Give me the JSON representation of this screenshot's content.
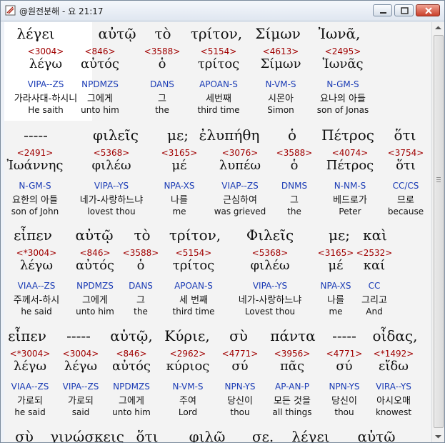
{
  "window": {
    "title": "@원전분해 - 요 21:17"
  },
  "blocks": [
    {
      "top_words": [
        "λέγει",
        "αὐτῷ",
        "τὸ",
        "τρίτον,",
        "Σίμων",
        "Ἰωνᾶ,"
      ],
      "entries": [
        {
          "num": "<3004>",
          "lemma": "λέγω",
          "parse": "VIPA--ZS",
          "kor": "가라사대-하시니",
          "eng": "He saith"
        },
        {
          "num": "<846>",
          "lemma": "αὐτός",
          "parse": "NPDMZS",
          "kor": "그에게",
          "eng": "unto him"
        },
        {
          "num": "<3588>",
          "lemma": "ὁ",
          "parse": "DANS",
          "kor": "그",
          "eng": "the"
        },
        {
          "num": "<5154>",
          "lemma": "τρίτος",
          "parse": "APOAN-S",
          "kor": "세번째",
          "eng": "third time"
        },
        {
          "num": "<4613>",
          "lemma": "Σίμων",
          "parse": "N-VM-S",
          "kor": "시몬아",
          "eng": "Simon"
        },
        {
          "num": "<2495>",
          "lemma": "Ἰωνᾶς",
          "parse": "N-GM-S",
          "kor": "요나의 아들",
          "eng": "son of Jonas"
        }
      ]
    },
    {
      "top_words": [
        "-----",
        "φιλεῖς",
        "με;",
        "ἐλυπήθη",
        "ὁ",
        "Πέτρος",
        "ὅτι"
      ],
      "entries": [
        {
          "num": "<2491>",
          "lemma": "Ἰωάννης",
          "parse": "N-GM-S",
          "kor": "요한의 아들",
          "eng": "son of John"
        },
        {
          "num": "<5368>",
          "lemma": "φιλέω",
          "parse": "VIPA--YS",
          "kor": "네가-사랑하느냐",
          "eng": "lovest thou"
        },
        {
          "num": "<3165>",
          "lemma": "μέ",
          "parse": "NPA-XS",
          "kor": "나를",
          "eng": "me"
        },
        {
          "num": "<3076>",
          "lemma": "λυπέω",
          "parse": "VIAP--ZS",
          "kor": "근심하여",
          "eng": "was grieved"
        },
        {
          "num": "<3588>",
          "lemma": "ὁ",
          "parse": "DNMS",
          "kor": "그",
          "eng": "the"
        },
        {
          "num": "<4074>",
          "lemma": "Πέτρος",
          "parse": "N-NM-S",
          "kor": "베드로가",
          "eng": "Peter"
        },
        {
          "num": "<3754>",
          "lemma": "ὅτι",
          "parse": "CC/CS",
          "kor": "므로",
          "eng": "because"
        }
      ]
    },
    {
      "top_words": [
        "εἶπεν",
        "αὐτῷ",
        "τὸ",
        "τρίτον,",
        "Φιλεῖς",
        "με;",
        "καὶ"
      ],
      "entries": [
        {
          "num": "<*3004>",
          "lemma": "λέγω",
          "parse": "VIAA--ZS",
          "kor": "주께서-하시",
          "eng": "he said"
        },
        {
          "num": "<846>",
          "lemma": "αὐτός",
          "parse": "NPDMZS",
          "kor": "그에게",
          "eng": "unto him"
        },
        {
          "num": "<3588>",
          "lemma": "ὁ",
          "parse": "DANS",
          "kor": "그",
          "eng": "the"
        },
        {
          "num": "<5154>",
          "lemma": "τρίτος",
          "parse": "APOAN-S",
          "kor": "세 번째",
          "eng": "third time"
        },
        {
          "num": "<5368>",
          "lemma": "φιλέω",
          "parse": "VIPA--YS",
          "kor": "네가-사랑하느냐",
          "eng": "Lovest thou"
        },
        {
          "num": "<3165>",
          "lemma": "μέ",
          "parse": "NPA-XS",
          "kor": "나를",
          "eng": "me"
        },
        {
          "num": "<2532>",
          "lemma": "καί",
          "parse": "CC",
          "kor": "그리고",
          "eng": "And"
        }
      ]
    },
    {
      "top_words": [
        "εἶπεν",
        "-----",
        "αὐτῷ,",
        "Κύριε,",
        "σὺ",
        "πάντα",
        "-----",
        "οἶδας,"
      ],
      "entries": [
        {
          "num": "<*3004>",
          "lemma": "λέγω",
          "parse": "VIAA--ZS",
          "kor": "가로되",
          "eng": "he said"
        },
        {
          "num": "<3004>",
          "lemma": "λέγω",
          "parse": "VIPA--ZS",
          "kor": "가로되",
          "eng": "said"
        },
        {
          "num": "<846>",
          "lemma": "αὐτός",
          "parse": "NPDMZS",
          "kor": "그에게",
          "eng": "unto him"
        },
        {
          "num": "<2962>",
          "lemma": "κύριος",
          "parse": "N-VM-S",
          "kor": "주여",
          "eng": "Lord"
        },
        {
          "num": "<4771>",
          "lemma": "σύ",
          "parse": "NPN-YS",
          "kor": "당신이",
          "eng": "thou"
        },
        {
          "num": "<3956>",
          "lemma": "πᾶς",
          "parse": "AP-AN-P",
          "kor": "모든 것을",
          "eng": "all things"
        },
        {
          "num": "<4771>",
          "lemma": "σύ",
          "parse": "NPN-YS",
          "kor": "당신이",
          "eng": "thou"
        },
        {
          "num": "<*1492>",
          "lemma": "εἴδω",
          "parse": "VIRA--YS",
          "kor": "아시오매",
          "eng": "knowest"
        }
      ]
    },
    {
      "top_words": [
        "σὺ",
        "γινώσκεις",
        "ὅτι",
        "φιλῶ",
        "σε.",
        "λέγει",
        "αὐτῷ"
      ]
    }
  ]
}
